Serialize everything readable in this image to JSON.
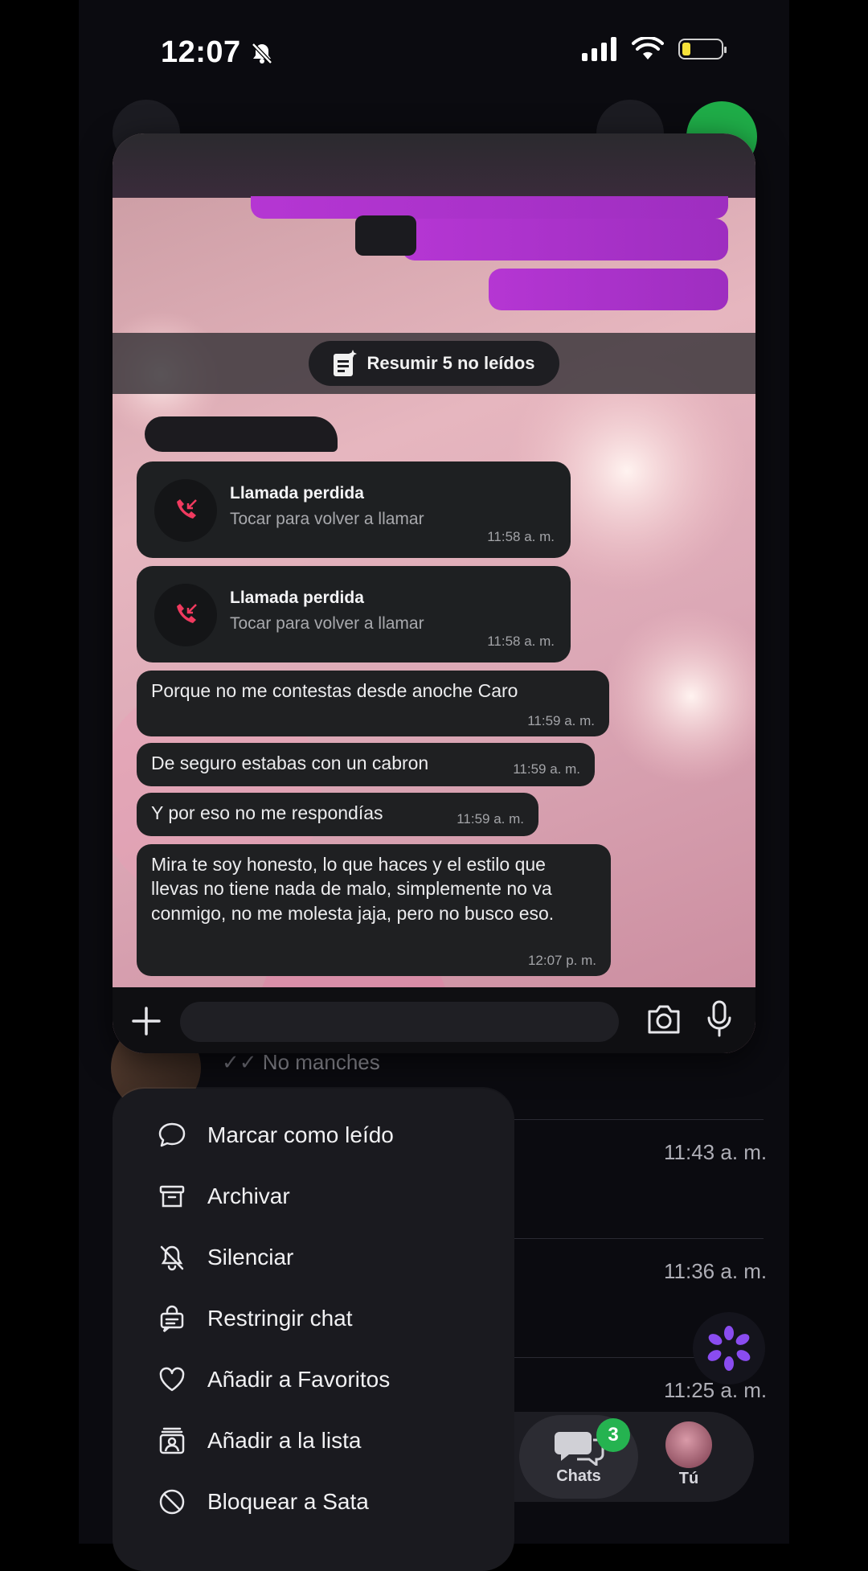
{
  "status": {
    "time": "12:07"
  },
  "background": {
    "preview_snippet": "No manches",
    "times": [
      "11:43 a. m.",
      "11:36 a. m.",
      "11:25 a. m."
    ]
  },
  "chat": {
    "summary_label": "Resumir 5 no leídos",
    "calls": [
      {
        "title": "Llamada perdida",
        "subtitle": "Tocar para volver a llamar",
        "time": "11:58 a. m."
      },
      {
        "title": "Llamada perdida",
        "subtitle": "Tocar para volver a llamar",
        "time": "11:58 a. m."
      }
    ],
    "messages": [
      {
        "text": "Porque no me contestas desde anoche Caro",
        "time": "11:59 a. m."
      },
      {
        "text": "De seguro estabas con un cabron",
        "time": "11:59 a. m."
      },
      {
        "text": "Y por eso no me respondías",
        "time": "11:59 a. m."
      },
      {
        "text": "Mira te soy honesto, lo que haces y el estilo que llevas no tiene nada de malo, simplemente no va conmigo, no me molesta jaja, pero no busco eso.",
        "time": "12:07 p. m."
      }
    ]
  },
  "menu": {
    "items": [
      {
        "label": "Marcar como leído",
        "icon": "chat-bubble-icon"
      },
      {
        "label": "Archivar",
        "icon": "archive-icon"
      },
      {
        "label": "Silenciar",
        "icon": "bell-off-icon"
      },
      {
        "label": "Restringir chat",
        "icon": "restrict-chat-icon"
      },
      {
        "label": "Añadir a Favoritos",
        "icon": "heart-icon"
      },
      {
        "label": "Añadir a la lista",
        "icon": "add-to-list-icon"
      },
      {
        "label": "Bloquear a Sata",
        "icon": "block-icon"
      }
    ]
  },
  "tabbar": {
    "chats_label": "Chats",
    "chats_badge": "3",
    "you_label": "Tú"
  },
  "colors": {
    "accent_green": "#25b350",
    "outgoing_bubble": "#b536d3",
    "missed_call": "#f03a5f"
  }
}
